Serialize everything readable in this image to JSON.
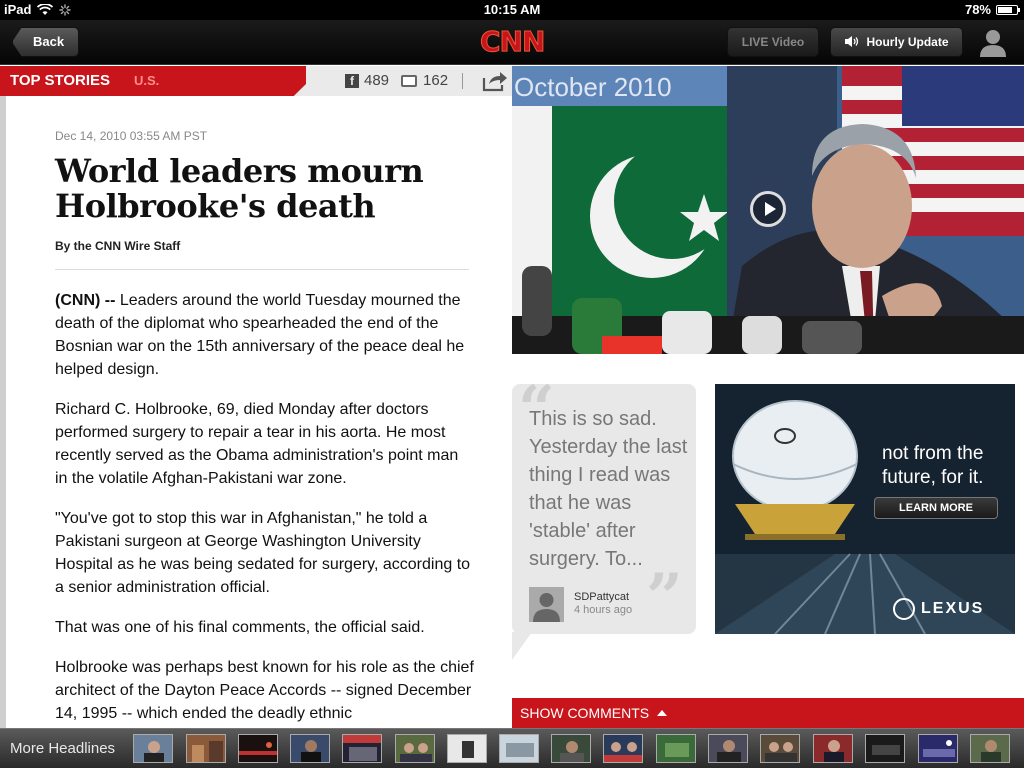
{
  "status_bar": {
    "device": "iPad",
    "time": "10:15 AM",
    "battery": "78%",
    "battery_level": 0.78
  },
  "nav": {
    "back_label": "Back",
    "logo": "CNN",
    "live_label": "LIVE Video",
    "hourly_label": "Hourly Update"
  },
  "section": {
    "top_stories": "TOP STORIES",
    "us": "U.S.",
    "facebook_count": "489",
    "comment_count": "162"
  },
  "article": {
    "dateline": "Dec 14, 2010 03:55 AM PST",
    "headline": "World leaders mourn Holbrooke's death",
    "byline": "By the CNN Wire Staff",
    "lead_tag": "(CNN) --",
    "paragraphs": [
      "Leaders around the world Tuesday mourned the death of the diplomat who spearheaded the end of the Bosnian war on the 15th anniversary of the peace deal he helped design.",
      "Richard C. Holbrooke, 69, died Monday after doctors performed surgery to repair a tear in his aorta. He most recently served as the Obama administration's point man in the volatile Afghan-Pakistani war zone.",
      "\"You've got to stop this war in Afghanistan,\" he told a Pakistani surgeon at George Washington University Hospital as he was being sedated for surgery, according to a senior administration official.",
      "That was one of his final comments, the official said.",
      "Holbrooke was perhaps best known for his role as the chief architect of the Dayton Peace Accords -- signed December 14, 1995 -- which ended the deadly ethnic"
    ]
  },
  "hero": {
    "date_overlay": "October 2010"
  },
  "comment": {
    "text": "This is so sad. Yesterday the last thing I read was that he was 'stable' after surgery.  To...",
    "author": "SDPattycat",
    "time": "4 hours ago"
  },
  "ad": {
    "tagline": "not from the future, for it.",
    "button": "LEARN MORE",
    "brand": "LEXUS"
  },
  "show_comments_label": "SHOW COMMENTS",
  "more_headlines": {
    "label": "More Headlines"
  }
}
